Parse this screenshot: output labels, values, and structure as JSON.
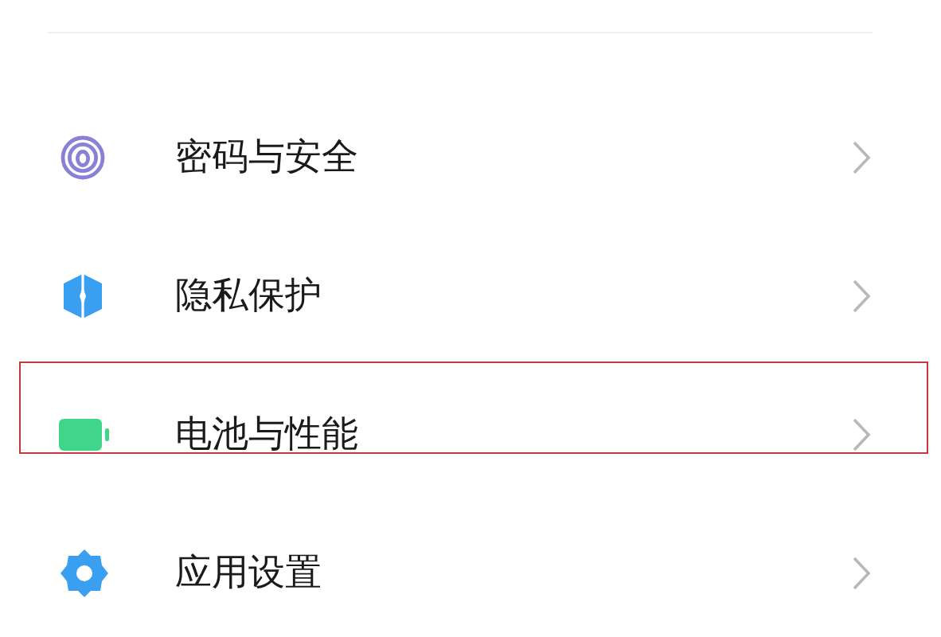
{
  "settings_items": [
    {
      "label": "密码与安全",
      "kind": "fingerprint",
      "highlighted": false
    },
    {
      "label": "隐私保护",
      "kind": "shield",
      "highlighted": false
    },
    {
      "label": "电池与性能",
      "kind": "battery",
      "highlighted": true
    },
    {
      "label": "应用设置",
      "kind": "gear",
      "highlighted": false
    }
  ]
}
